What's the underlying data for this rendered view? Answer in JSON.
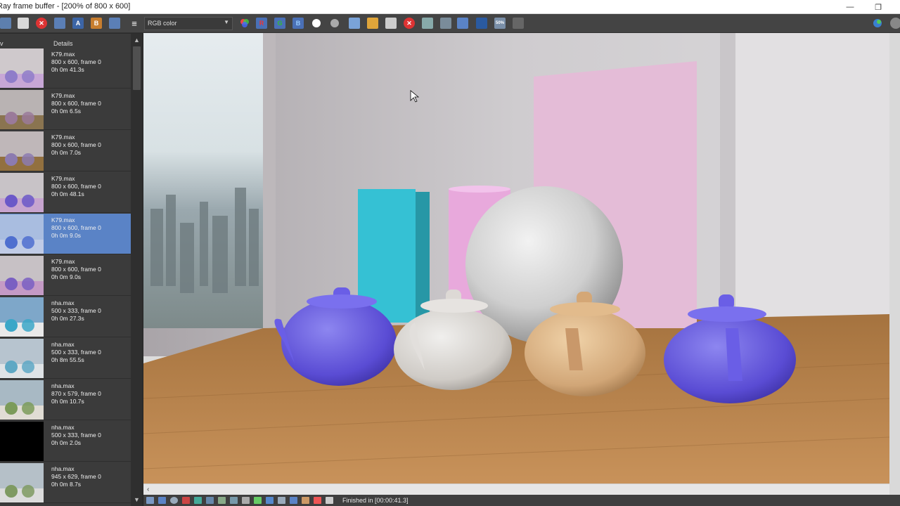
{
  "window": {
    "title": "Ray frame buffer - [200% of 800 x 600]",
    "minimize_glyph": "—",
    "restore_glyph": "❐"
  },
  "toolbar": {
    "channel_select": "RGB color",
    "red_label": "R",
    "green_label": "G",
    "blue_label": "B",
    "text_label_a": "A",
    "text_label_b": "B",
    "zoom_badge": "50%"
  },
  "history": {
    "header_left": "v",
    "header_details": "Details",
    "items": [
      {
        "name": "K79.max",
        "res": "800 x 600, frame 0",
        "time": "0h 0m 41.3s"
      },
      {
        "name": "K79.max",
        "res": "800 x 600, frame 0",
        "time": "0h 0m 6.5s"
      },
      {
        "name": "K79.max",
        "res": "800 x 600, frame 0",
        "time": "0h 0m 7.0s"
      },
      {
        "name": "K79.max",
        "res": "800 x 600, frame 0",
        "time": "0h 0m 48.1s"
      },
      {
        "name": "K79.max",
        "res": "800 x 600, frame 0",
        "time": "0h 0m 9.0s"
      },
      {
        "name": "K79.max",
        "res": "800 x 600, frame 0",
        "time": "0h 0m 9.0s"
      },
      {
        "name": "nha.max",
        "res": "500 x 333, frame 0",
        "time": "0h 0m 27.3s"
      },
      {
        "name": "nha.max",
        "res": "500 x 333, frame 0",
        "time": "0h 8m 55.5s"
      },
      {
        "name": "nha.max",
        "res": "870 x 579, frame 0",
        "time": "0h 0m 10.7s"
      },
      {
        "name": "nha.max",
        "res": "500 x 333, frame 0",
        "time": "0h 0m 2.0s"
      },
      {
        "name": "nha.max",
        "res": "945 x 629, frame 0",
        "time": "0h 0m 8.7s"
      }
    ],
    "selected_index": 4
  },
  "status": {
    "text": "Finished in [00:00:41.3]"
  },
  "colors": {
    "accent": "#5a83c6",
    "panel": "#3b3b3b",
    "toolbar": "#444444"
  }
}
